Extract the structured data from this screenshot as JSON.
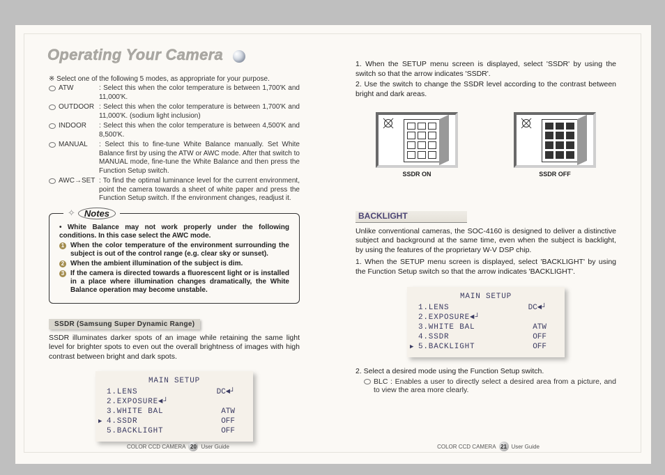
{
  "title": "Operating Your Camera",
  "left": {
    "intro": "※ Select one of the following 5 modes, as appropriate for your purpose.",
    "modes": {
      "atw": {
        "label": "ATW",
        "desc": "Select this when the color temperature is between 1,700'K and 11,000'K."
      },
      "outdoor": {
        "label": "OUTDOOR",
        "desc": "Select this when the color temperature is between 1,700'K and 11,000'K. (sodium light inclusion)"
      },
      "indoor": {
        "label": "INDOOR",
        "desc": "Select this when the color temperature is between 4,500'K and 8,500'K."
      },
      "manual": {
        "label": "MANUAL",
        "desc": "Select this to fine-tune White Balance manually. Set White Balance first by using the ATW or AWC mode. After that switch to MANUAL mode, fine-tune the White Balance and then press the Function Setup switch."
      },
      "awc": {
        "label": "AWC→SET",
        "desc": "To find the optimal luminance level for the current environment, point the camera towards a sheet of white paper and press the Function Setup switch. If the environment changes, readjust it."
      }
    },
    "notes": {
      "title": "Notes",
      "lead": "• White Balance may not work properly under the following conditions. In this case select the AWC mode.",
      "items": [
        "When the color temperature of the environment surrounding the subject is out of the control range (e.g. clear sky or sunset).",
        "When the ambient illumination of the subject is dim.",
        "If the camera is directed towards a fluorescent light or is installed in a place where illumination changes dramatically, the White Balance operation may become unstable."
      ]
    },
    "ssdr_label": "SSDR (Samsung Super Dynamic Range)",
    "ssdr_text": "SSDR illuminates darker spots of an image while retaining the same light level for brighter spots to even out the overall brightness of images with high contrast between bright and dark spots.",
    "menu": {
      "title": "MAIN SETUP",
      "rows": [
        {
          "n": "1.LENS",
          "v": "DC◄┘"
        },
        {
          "n": "2.EXPOSURE◄┘",
          "v": ""
        },
        {
          "n": "3.WHITE BAL",
          "v": "ATW"
        },
        {
          "n": "4.SSDR",
          "v": "OFF",
          "sel": true
        },
        {
          "n": "5.BACKLIGHT",
          "v": "OFF"
        }
      ]
    },
    "footer": {
      "product": "COLOR CCD CAMERA",
      "page": "20",
      "label": "User Guide"
    }
  },
  "right": {
    "step1": "1. When the SETUP menu screen is displayed, select 'SSDR' by using the switch so that the arrow indicates 'SSDR'.",
    "step2": "2. Use the switch to change the SSDR level according to the contrast between bright and dark areas.",
    "cap_on": "SSDR ON",
    "cap_off": "SSDR OFF",
    "backlight_heading": "BACKLIGHT",
    "backlight_para": "Unlike conventional cameras, the SOC-4160 is designed to deliver a distinctive subject and background at the same time, even when the subject is backlight, by using the features of the proprietary W-V DSP chip.",
    "backlight_step1": "1. When the SETUP menu screen is displayed, select 'BACKLIGHT' by using the Function Setup switch so that the arrow indicates 'BACKLIGHT'.",
    "menu": {
      "title": "MAIN SETUP",
      "rows": [
        {
          "n": "1.LENS",
          "v": "DC◄┘"
        },
        {
          "n": "2.EXPOSURE◄┘",
          "v": ""
        },
        {
          "n": "3.WHITE BAL",
          "v": "ATW"
        },
        {
          "n": "4.SSDR",
          "v": "OFF"
        },
        {
          "n": "5.BACKLIGHT",
          "v": "OFF",
          "sel": true
        }
      ]
    },
    "after_menu": "2. Select a desired mode using the Function Setup switch.",
    "blc": "BLC : Enables a user to directly select a desired area from a picture, and to view the area more clearly.",
    "footer": {
      "product": "COLOR CCD CAMERA",
      "page": "21",
      "label": "User Guide"
    }
  }
}
